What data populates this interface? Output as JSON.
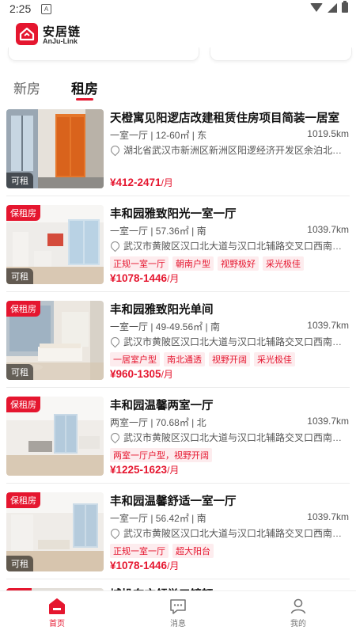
{
  "status_bar": {
    "time": "2:25",
    "notification_glyph": "A"
  },
  "app": {
    "name_cn": "安居链",
    "name_en": "AnJu-Link",
    "brand_color": "#e5162f"
  },
  "tabs": [
    {
      "label": "新房",
      "active": false
    },
    {
      "label": "租房",
      "active": true
    }
  ],
  "listings": [
    {
      "badge": "",
      "status": "可租",
      "title": "天橙寓见阳逻店改建租赁住房项目简装一居室",
      "spec": "一室一厅 | 12-60㎡ | 东",
      "distance": "1019.5km",
      "address": "湖北省武汉市新洲区新洲区阳逻经济开发区余泊北…",
      "tags": [],
      "price": "¥412-2471",
      "price_unit": "/月"
    },
    {
      "badge": "保租房",
      "status": "可租",
      "title": "丰和园雅致阳光一室一厅",
      "spec": "一室一厅 | 57.36㎡ | 南",
      "distance": "1039.7km",
      "address": "武汉市黄陂区汉口北大道与汉口北辅路交叉口西南…",
      "tags": [
        "正规一室一厅",
        "朝南户型",
        "视野极好",
        "采光极佳"
      ],
      "price": "¥1078-1446",
      "price_unit": "/月"
    },
    {
      "badge": "保租房",
      "status": "可租",
      "title": "丰和园雅致阳光单间",
      "spec": "一室一厅 | 49-49.56㎡ | 南",
      "distance": "1039.7km",
      "address": "武汉市黄陂区汉口北大道与汉口北辅路交叉口西南…",
      "tags": [
        "一居室户型",
        "南北通透",
        "视野开阔",
        "采光极佳"
      ],
      "price": "¥960-1305",
      "price_unit": "/月"
    },
    {
      "badge": "保租房",
      "status": "",
      "title": "丰和园温馨两室一厅",
      "spec": "两室一厅 | 70.68㎡ | 北",
      "distance": "1039.7km",
      "address": "武汉市黄陂区汉口北大道与汉口北辅路交叉口西南…",
      "tags": [
        "两室一厅户型，视野开阔"
      ],
      "price": "¥1225-1623",
      "price_unit": "/月"
    },
    {
      "badge": "保租房",
      "status": "可租",
      "title": "丰和园温馨舒适一室一厅",
      "spec": "一室一厅 | 56.42㎡ | 南",
      "distance": "1039.7km",
      "address": "武汉市黄陂区汉口北大道与汉口北辅路交叉口西南…",
      "tags": [
        "正规一室一厅",
        "超大阳台"
      ],
      "price": "¥1078-1446",
      "price_unit": "/月"
    },
    {
      "badge": "",
      "status": "",
      "title": "城投东方领誉三镜轩",
      "spec": "",
      "distance": "",
      "address": "",
      "tags": [],
      "price": "",
      "price_unit": ""
    }
  ],
  "bottom_nav": [
    {
      "label": "首页",
      "icon": "home-icon",
      "active": true
    },
    {
      "label": "消息",
      "icon": "message-icon",
      "active": false
    },
    {
      "label": "我的",
      "icon": "profile-icon",
      "active": false
    }
  ]
}
